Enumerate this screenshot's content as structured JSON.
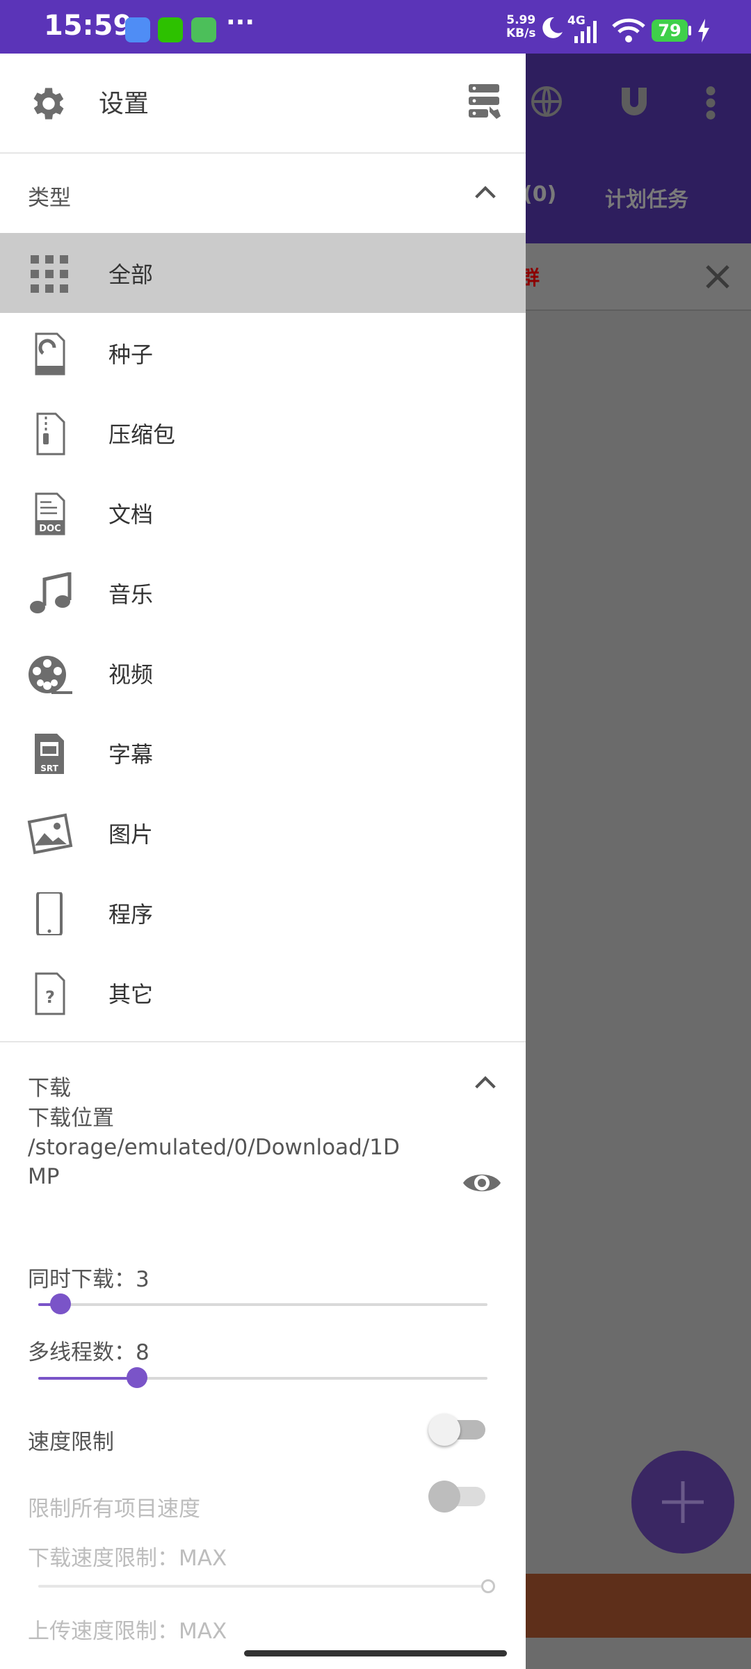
{
  "status_bar": {
    "time": "15:59",
    "net_speed_value": "5.99",
    "net_speed_unit": "KB/s",
    "network": "4G",
    "battery": "79",
    "more": "···",
    "icons": [
      "gallery-app-icon",
      "wechat-icon",
      "tool-app-icon",
      "moon-icon",
      "signal-icon",
      "wifi-icon",
      "battery-icon",
      "charging-icon"
    ]
  },
  "drawer": {
    "header": {
      "title": "设置",
      "icons": [
        "gear-icon",
        "server-settings-icon"
      ]
    },
    "type_section": {
      "title": "类型",
      "items": [
        {
          "label": "全部",
          "icon": "grid-icon",
          "selected": true
        },
        {
          "label": "种子",
          "icon": "torrent-icon"
        },
        {
          "label": "压缩包",
          "icon": "archive-icon"
        },
        {
          "label": "文档",
          "icon": "document-icon"
        },
        {
          "label": "音乐",
          "icon": "music-icon"
        },
        {
          "label": "视频",
          "icon": "film-reel-icon"
        },
        {
          "label": "字幕",
          "icon": "subtitle-icon"
        },
        {
          "label": "图片",
          "icon": "image-icon"
        },
        {
          "label": "程序",
          "icon": "phone-app-icon"
        },
        {
          "label": "其它",
          "icon": "unknown-file-icon"
        }
      ]
    },
    "download_section": {
      "title": "下载",
      "location_label": "下载位置",
      "location_path": "/storage/emulated/0/Download/1DMP",
      "concurrent_label": "同时下载：3",
      "concurrent_value": 3,
      "concurrent_fraction": 0.05,
      "threads_label": "多线程数：8",
      "threads_value": 8,
      "threads_fraction": 0.22,
      "speed_limit_label": "速度限制",
      "speed_limit_on": false,
      "limit_all_label": "限制所有项目速度",
      "limit_all_on": false,
      "download_limit_label": "下载速度限制：MAX",
      "upload_limit_label": "上传速度限制：MAX"
    }
  },
  "background_app": {
    "tab_partial": "(0)",
    "tab_scheduled": "计划任务",
    "banner_partial": "群"
  },
  "colors": {
    "status_bar": "#5b34b8",
    "accent": "#7a54c8",
    "selected_item_bg": "#cbcbcb",
    "icon_gray": "#6d6d6d"
  }
}
